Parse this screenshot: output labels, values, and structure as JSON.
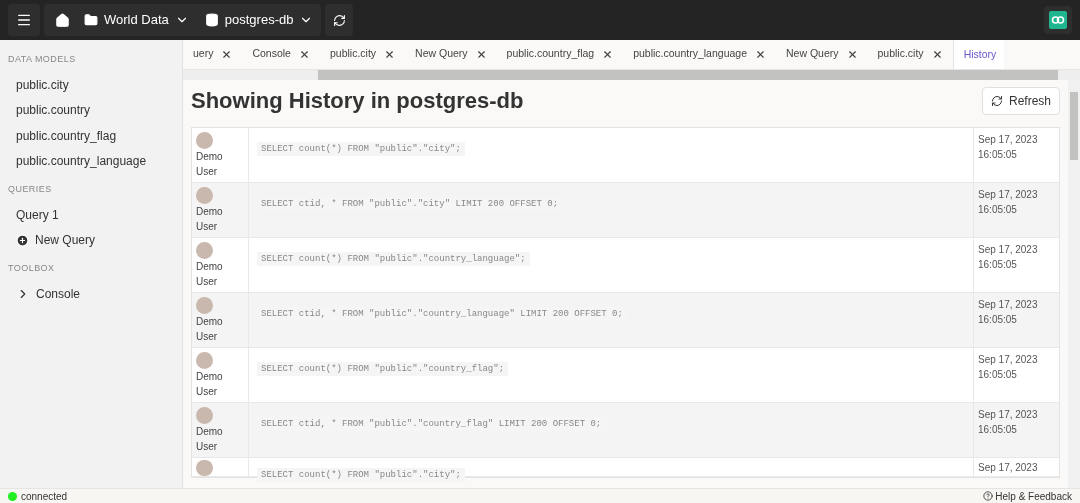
{
  "topbar": {
    "breadcrumbs": [
      {
        "kind": "folder",
        "label": "World Data"
      },
      {
        "kind": "database",
        "label": "postgres-db"
      }
    ]
  },
  "sidebar": {
    "sections": [
      {
        "title": "DATA MODELS",
        "items": [
          {
            "kind": "plain",
            "label": "public.city"
          },
          {
            "kind": "plain",
            "label": "public.country"
          },
          {
            "kind": "plain",
            "label": "public.country_flag"
          },
          {
            "kind": "plain",
            "label": "public.country_language"
          }
        ]
      },
      {
        "title": "QUERIES",
        "items": [
          {
            "kind": "plain",
            "label": "Query 1"
          },
          {
            "kind": "add",
            "label": "New Query"
          }
        ]
      },
      {
        "title": "TOOLBOX",
        "items": [
          {
            "kind": "terminal",
            "label": "Console"
          }
        ]
      }
    ]
  },
  "tabs": [
    {
      "label": "uery",
      "selected": false,
      "closable": true
    },
    {
      "label": "Console",
      "selected": false,
      "closable": true
    },
    {
      "label": "public.city",
      "selected": false,
      "closable": true
    },
    {
      "label": "New Query",
      "selected": false,
      "closable": true
    },
    {
      "label": "public.country_flag",
      "selected": false,
      "closable": true
    },
    {
      "label": "public.country_language",
      "selected": false,
      "closable": true
    },
    {
      "label": "New Query",
      "selected": false,
      "closable": true
    },
    {
      "label": "public.city",
      "selected": false,
      "closable": true
    },
    {
      "label": "History",
      "selected": true,
      "closable": false
    }
  ],
  "page": {
    "title": "Showing History in postgres-db",
    "refresh_button": "Refresh"
  },
  "history": [
    {
      "user": "Demo User",
      "sql": "SELECT count(*) FROM \"public\".\"city\";",
      "date": "Sep 17, 2023",
      "time": "16:05:05"
    },
    {
      "user": "Demo User",
      "sql": "SELECT ctid, * FROM \"public\".\"city\" LIMIT 200 OFFSET 0;",
      "date": "Sep 17, 2023",
      "time": "16:05:05"
    },
    {
      "user": "Demo User",
      "sql": "SELECT count(*) FROM \"public\".\"country_language\";",
      "date": "Sep 17, 2023",
      "time": "16:05:05"
    },
    {
      "user": "Demo User",
      "sql": "SELECT ctid, * FROM \"public\".\"country_language\" LIMIT 200 OFFSET 0;",
      "date": "Sep 17, 2023",
      "time": "16:05:05"
    },
    {
      "user": "Demo User",
      "sql": "SELECT count(*) FROM \"public\".\"country_flag\";",
      "date": "Sep 17, 2023",
      "time": "16:05:05"
    },
    {
      "user": "Demo User",
      "sql": "SELECT ctid, * FROM \"public\".\"country_flag\" LIMIT 200 OFFSET 0;",
      "date": "Sep 17, 2023",
      "time": "16:05:05"
    },
    {
      "sql": "SELECT count(*) FROM \"public\".\"city\";",
      "date": "Sep 17, 2023"
    }
  ],
  "status_bar": {
    "connection": "connected",
    "connected": true,
    "help": "Help & Feedback"
  }
}
